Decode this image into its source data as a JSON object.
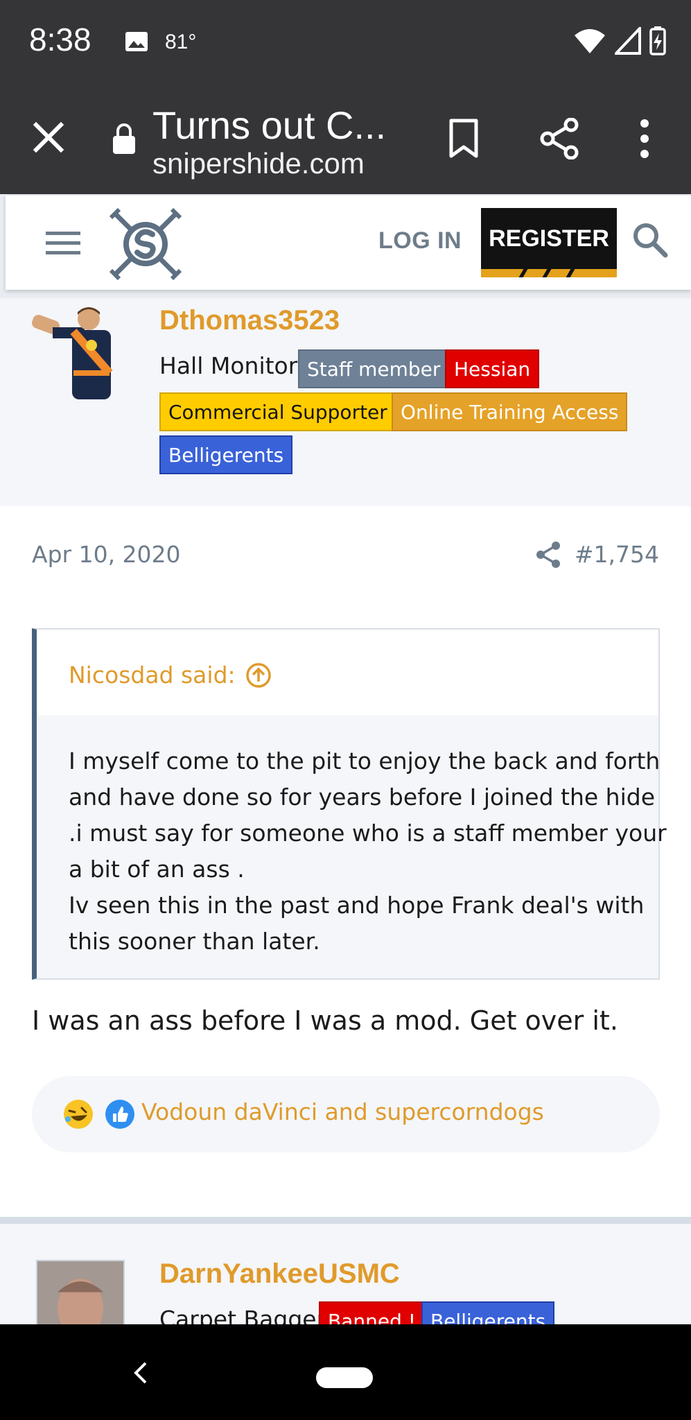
{
  "status_bar": {
    "time": "8:38",
    "temperature": "81°",
    "icons": [
      "image-icon",
      "wifi-icon",
      "signal-icon",
      "battery-charging-icon"
    ]
  },
  "browser": {
    "title": "Turns out C...",
    "url": "snipershide.com",
    "icons": [
      "close-icon",
      "lock-icon",
      "bookmark-icon",
      "share-icon",
      "overflow-menu-icon"
    ]
  },
  "site_header": {
    "login_label": "LOG IN",
    "register_label": "REGISTER",
    "icons": [
      "hamburger-icon",
      "snipershide-logo",
      "search-icon"
    ],
    "accent_color": "#e4a11b"
  },
  "post": {
    "user": {
      "name": "Dthomas3523",
      "title": "Hall Monitor",
      "badges": [
        {
          "label": "Staff member",
          "bg": "#6e8197",
          "fg": "#ffffff"
        },
        {
          "label": "Hessian",
          "bg": "#e00000",
          "fg": "#ffffff"
        },
        {
          "label": "Commercial Supporter",
          "bg": "#ffcc00",
          "fg": "#141414"
        },
        {
          "label": "Online Training Access",
          "bg": "#e5a228",
          "fg": "#ffffff"
        },
        {
          "label": "Belligerents",
          "bg": "#3a62d8",
          "fg": "#ffffff"
        }
      ]
    },
    "date": "Apr 10, 2020",
    "number": "#1,754",
    "quote": {
      "author": "Nicosdad said:",
      "lines": [
        "I myself come to the pit to enjoy the back and forth",
        "and have done so for years before I joined the hide",
        ".i must say for someone who is a staff member your",
        "a bit of an ass .",
        "Iv seen this in the past and hope Frank deal's with",
        "this sooner than later."
      ]
    },
    "text": "I was an ass before I was a mod. Get over it.",
    "reactions": {
      "types": [
        "laugh-reaction-icon",
        "like-reaction-icon"
      ],
      "users": "Vodoun daVinci and supercorndogs"
    }
  },
  "next_post": {
    "user": {
      "name": "DarnYankeeUSMC",
      "title": "Carpet Bagger",
      "badges": [
        {
          "label": "Banned !",
          "bg": "#e00000",
          "fg": "#ffffff"
        },
        {
          "label": "Belligerents",
          "bg": "#3a62d8",
          "fg": "#ffffff"
        }
      ]
    }
  },
  "colors": {
    "username": "#e09a2b",
    "muted": "#6d7c8a",
    "quote_border": "#47607e"
  }
}
